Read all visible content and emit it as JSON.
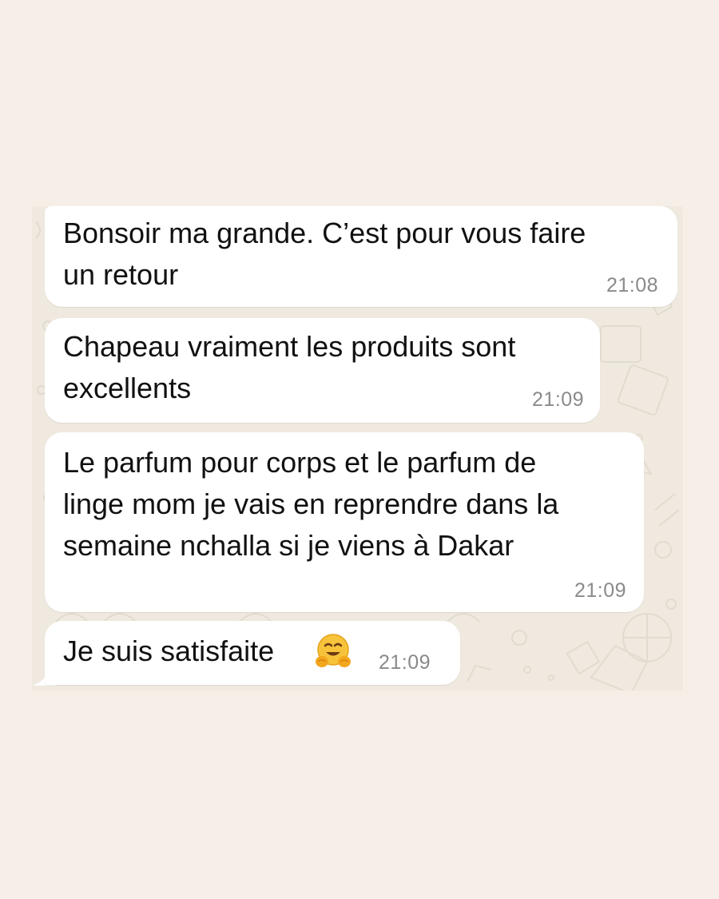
{
  "chat": {
    "messages": [
      {
        "text": "Bonsoir ma grande. C’est pour vous faire\nun retour",
        "time": "21:08"
      },
      {
        "text": "Chapeau vraiment les produits sont\nexcellents",
        "time": "21:09"
      },
      {
        "text": "Le parfum pour corps et le parfum de\nlinge mom je vais en reprendre dans la\nsemaine nchalla si je viens à Dakar",
        "time": "21:09"
      },
      {
        "text": "Je suis satisfaite",
        "time": "21:09",
        "emoji": "hugging-face-emoji"
      }
    ]
  },
  "colors": {
    "page_background": "#f5efe8",
    "chat_background": "#efe9df",
    "bubble": "#ffffff",
    "text": "#111111",
    "timestamp": "#8a8a8a"
  }
}
